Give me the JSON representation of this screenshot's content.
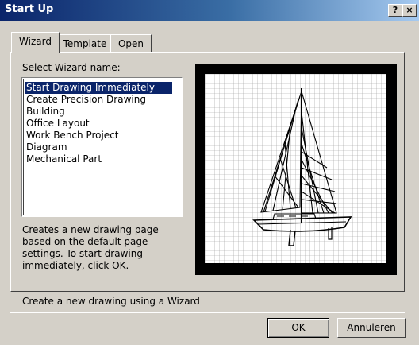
{
  "window": {
    "title": "Start Up"
  },
  "titlebar_buttons": {
    "help_label": "?",
    "close_label": "×"
  },
  "tabs": [
    {
      "label": "Wizard",
      "active": true
    },
    {
      "label": "Template",
      "active": false
    },
    {
      "label": "Open",
      "active": false
    }
  ],
  "wizard": {
    "list_label": "Select Wizard name:",
    "items": [
      "Start Drawing Immediately",
      "Create Precision Drawing",
      "Building",
      "Office Layout",
      "Work Bench Project",
      "Diagram",
      "Mechanical Part"
    ],
    "selected_index": 0,
    "description_lines": [
      "Creates a new drawing page",
      "based on the default page",
      "settings.  To start drawing",
      "immediately, click OK."
    ]
  },
  "preview": {
    "image_name": "sailboat-preview"
  },
  "status_text": "Create a new drawing using a Wizard",
  "buttons": {
    "ok_label": "OK",
    "cancel_label": "Annuleren"
  },
  "colors": {
    "titlebar_start": "#0a246a",
    "selection": "#0a246a",
    "face": "#d4d0c8"
  }
}
